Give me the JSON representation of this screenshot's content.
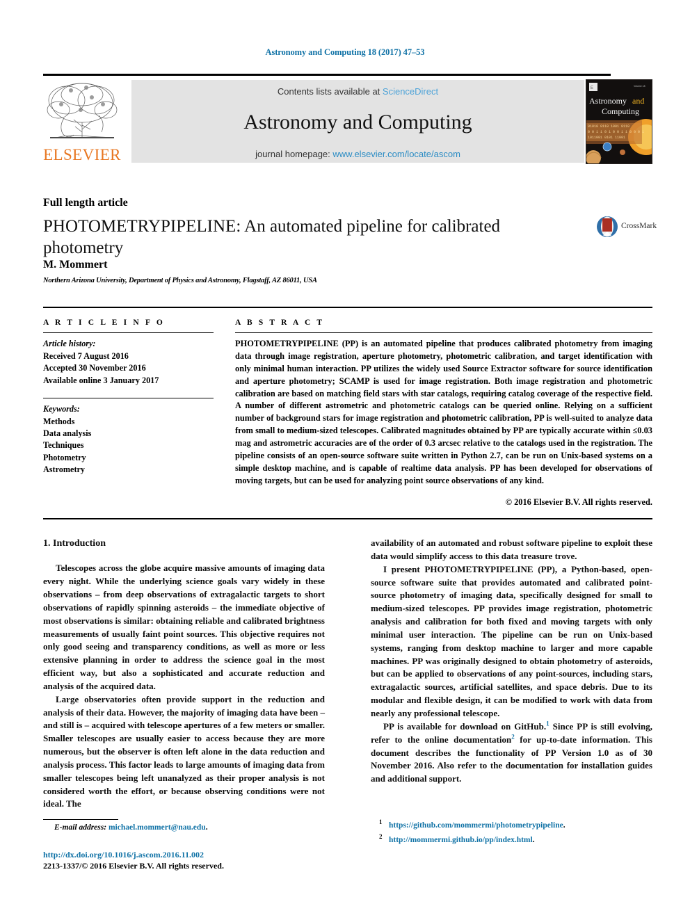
{
  "running_head": "Astronomy and Computing 18 (2017) 47–53",
  "masthead": {
    "contents_prefix": "Contents lists available at ",
    "sciencedirect": "ScienceDirect",
    "journal_title": "Astronomy and Computing",
    "homepage_prefix": "journal homepage: ",
    "homepage_url": "www.elsevier.com/locate/ascom",
    "publisher": "ELSEVIER",
    "cover_line1": "Astronomy",
    "cover_and": "and",
    "cover_line2": "Computing",
    "accent_blue": "#2b8cc4",
    "band_grey": "#e3e3e3",
    "elsevier_orange": "#e87722"
  },
  "article": {
    "type_label": "Full length article",
    "title": "PHOTOMETRYPIPELINE: An automated pipeline for calibrated photometry",
    "author": "M. Mommert",
    "affiliation": "Northern Arizona University, Department of Physics and Astronomy, Flagstaff, AZ 86011, USA",
    "crossmark_label": "CrossMark"
  },
  "info": {
    "heading": "A R T I C L E   I N F O",
    "history_label": "Article history:",
    "history": [
      "Received 7 August 2016",
      "Accepted 30 November 2016",
      "Available online 3 January 2017"
    ],
    "keywords_label": "Keywords:",
    "keywords": [
      "Methods",
      "Data analysis",
      "Techniques",
      "Photometry",
      "Astrometry"
    ]
  },
  "abstract": {
    "heading": "A B S T R A C T",
    "text": "PHOTOMETRYPIPELINE (PP) is an automated pipeline that produces calibrated photometry from imaging data through image registration, aperture photometry, photometric calibration, and target identification with only minimal human interaction. PP utilizes the widely used Source Extractor software for source identification and aperture photometry; SCAMP is used for image registration. Both image registration and photometric calibration are based on matching field stars with star catalogs, requiring catalog coverage of the respective field. A number of different astrometric and photometric catalogs can be queried online. Relying on a sufficient number of background stars for image registration and photometric calibration, PP is well-suited to analyze data from small to medium-sized telescopes. Calibrated magnitudes obtained by PP are typically accurate within ≤0.03 mag and astrometric accuracies are of the order of 0.3 arcsec relative to the catalogs used in the registration. The pipeline consists of an open-source software suite written in Python 2.7, can be run on Unix-based systems on a simple desktop machine, and is capable of realtime data analysis. PP has been developed for observations of moving targets, but can be used for analyzing point source observations of any kind.",
    "copyright": "© 2016 Elsevier B.V. All rights reserved."
  },
  "body": {
    "section_number_title": "1.  Introduction",
    "left_paragraphs": [
      "Telescopes across the globe acquire massive amounts of imaging data every night. While the underlying science goals vary widely in these observations – from deep observations of extragalactic targets to short observations of rapidly spinning asteroids – the immediate objective of most observations is similar: obtaining reliable and calibrated brightness measurements of usually faint point sources. This objective requires not only good seeing and transparency conditions, as well as more or less extensive planning in order to address the science goal in the most efficient way, but also a sophisticated and accurate reduction and analysis of the acquired data.",
      "Large observatories often provide support in the reduction and analysis of their data. However, the majority of imaging data have been – and still is – acquired with telescope apertures of a few meters or smaller. Smaller telescopes are usually easier to access because they are more numerous, but the observer is often left alone in the data reduction and analysis process. This factor leads to large amounts of imaging data from smaller telescopes being left unanalyzed as their proper analysis is not considered worth the effort, or because observing conditions were not ideal. The"
    ],
    "right_paragraph_continuation": "availability of an automated and robust software pipeline to exploit these data would simplify access to this data treasure trove.",
    "right_paragraph_2": "I present PHOTOMETRYPIPELINE (PP), a Python-based, open-source software suite that provides automated and calibrated point-source photometry of imaging data, specifically designed for small to medium-sized telescopes. PP provides image registration, photometric analysis and calibration for both fixed and moving targets with only minimal user interaction. The pipeline can be run on Unix-based systems, ranging from desktop machine to larger and more capable machines. PP was originally designed to obtain photometry of asteroids, but can be applied to observations of any point-sources, including stars, extragalactic sources, artificial satellites, and space debris. Due to its modular and flexible design, it can be modified to work with data from nearly any professional telescope.",
    "right_paragraph_3a": "PP is available for download on GitHub.",
    "right_paragraph_3b": "  Since PP is still evolving, refer to the online documentation",
    "right_paragraph_3c": " for up-to-date information. This document describes the functionality of PP Version 1.0 as of 30 November 2016. Also refer to the documentation for installation guides and additional support."
  },
  "footnotes": {
    "email_label": "E-mail address:",
    "email": "michael.mommert@nau.edu",
    "email_trail": ".",
    "doi": "http://dx.doi.org/10.1016/j.ascom.2016.11.002",
    "issn_copyright": "2213-1337/© 2016 Elsevier B.V. All rights reserved.",
    "items": [
      {
        "num": "1",
        "url": "https://github.com/mommermi/photometrypipeline",
        "trail": "."
      },
      {
        "num": "2",
        "url": "http://mommermi.github.io/pp/index.html",
        "trail": "."
      }
    ]
  }
}
